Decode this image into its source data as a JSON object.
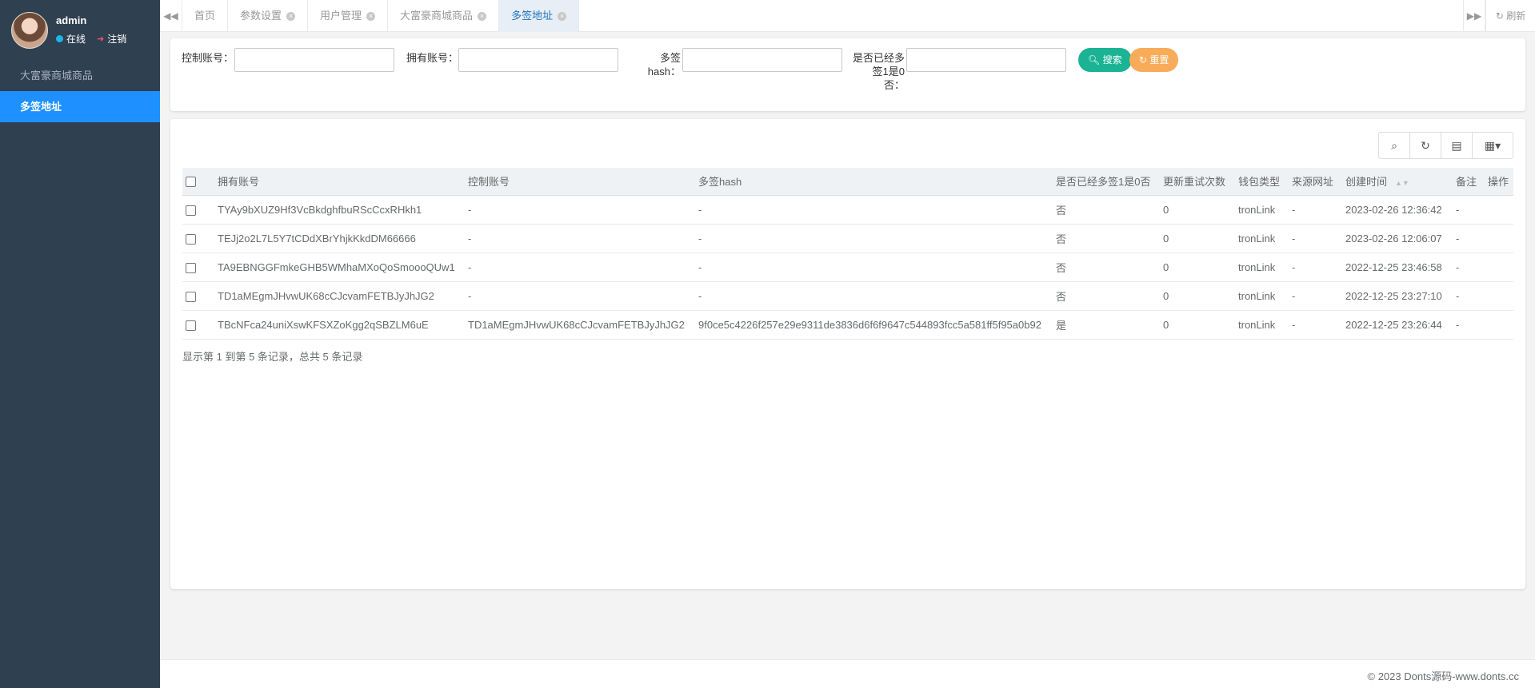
{
  "user": {
    "name": "admin",
    "status": "在线",
    "signout": "注销"
  },
  "sidebar": {
    "items": [
      {
        "label": "大富豪商城商品",
        "active": false
      },
      {
        "label": "多签地址",
        "active": true
      }
    ]
  },
  "tabs": {
    "items": [
      {
        "label": "首页",
        "closable": false
      },
      {
        "label": "参数设置",
        "closable": true
      },
      {
        "label": "用户管理",
        "closable": true
      },
      {
        "label": "大富豪商城商品",
        "closable": true
      },
      {
        "label": "多签地址",
        "closable": true,
        "active": true
      }
    ],
    "refresh_label": "刷新"
  },
  "search": {
    "control_label": "控制账号：",
    "owner_label": "拥有账号：",
    "hash_label_1": "多签",
    "hash_label_2": "hash：",
    "multisig_label_1": "是否已经多",
    "multisig_label_2": "签1是0",
    "multisig_label_3": "否：",
    "search_button": "搜索",
    "reset_button": "重置"
  },
  "table": {
    "columns": [
      "拥有账号",
      "控制账号",
      "多签hash",
      "是否已经多签1是0否",
      "更新重试次数",
      "钱包类型",
      "来源网址",
      "创建时间",
      "备注",
      "操作"
    ],
    "rows": [
      {
        "owner": "TYAy9bXUZ9Hf3VcBkdghfbuRScCcxRHkh1",
        "control": "-",
        "hash": "-",
        "multisig": "否",
        "retries": "0",
        "wallet": "tronLink",
        "source": "-",
        "created": "2023-02-26 12:36:42",
        "remark": "-"
      },
      {
        "owner": "TEJj2o2L7L5Y7tCDdXBrYhjkKkdDM66666",
        "control": "-",
        "hash": "-",
        "multisig": "否",
        "retries": "0",
        "wallet": "tronLink",
        "source": "-",
        "created": "2023-02-26 12:06:07",
        "remark": "-"
      },
      {
        "owner": "TA9EBNGGFmkeGHB5WMhaMXoQoSmoooQUw1",
        "control": "-",
        "hash": "-",
        "multisig": "否",
        "retries": "0",
        "wallet": "tronLink",
        "source": "-",
        "created": "2022-12-25 23:46:58",
        "remark": "-"
      },
      {
        "owner": "TD1aMEgmJHvwUK68cCJcvamFETBJyJhJG2",
        "control": "-",
        "hash": "-",
        "multisig": "否",
        "retries": "0",
        "wallet": "tronLink",
        "source": "-",
        "created": "2022-12-25 23:27:10",
        "remark": "-"
      },
      {
        "owner": "TBcNFca24uniXswKFSXZoKgg2qSBZLM6uE",
        "control": "TD1aMEgmJHvwUK68cCJcvamFETBJyJhJG2",
        "hash": "9f0ce5c4226f257e29e9311de3836d6f6f9647c544893fcc5a581ff5f95a0b92",
        "multisig": "是",
        "retries": "0",
        "wallet": "tronLink",
        "source": "-",
        "created": "2022-12-25 23:26:44",
        "remark": "-"
      }
    ],
    "page_info": "显示第 1 到第 5 条记录，总共 5 条记录"
  },
  "footer": {
    "copyright": "© 2023 Donts源码-www.donts.cc"
  },
  "colors": {
    "sidebar": "#2f4050",
    "active_nav": "#1e90ff",
    "search_btn": "#1ab394",
    "reset_btn": "#f8ac59"
  }
}
